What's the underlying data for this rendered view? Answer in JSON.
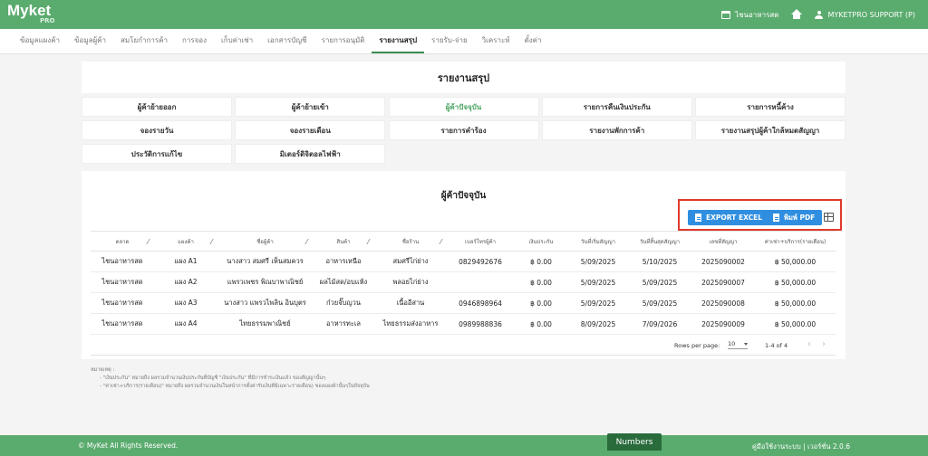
{
  "app": {
    "logo": "Myket",
    "logo_sub": "PRO"
  },
  "topbar": {
    "market_name": "ไชนอาหารสด",
    "user": "MYKETPRO SUPPORT (P)"
  },
  "nav": [
    {
      "label": "ข้อมูลแผงค้า",
      "active": false
    },
    {
      "label": "ข้อมูลผู้ค้า",
      "active": false
    },
    {
      "label": "สมโยกำการค้า",
      "active": false
    },
    {
      "label": "การจอง",
      "active": false
    },
    {
      "label": "เก็บค่าเช่า",
      "active": false
    },
    {
      "label": "เอกสารบัญชี",
      "active": false
    },
    {
      "label": "รายการอนุมัติ",
      "active": false
    },
    {
      "label": "รายงานสรุป",
      "active": true
    },
    {
      "label": "รายรับ-จ่าย",
      "active": false
    },
    {
      "label": "วิเคราะห์",
      "active": false
    },
    {
      "label": "ตั้งค่า",
      "active": false
    }
  ],
  "page_title": "รายงานสรุป",
  "reports": [
    {
      "label": "ผู้ค้าย้ายออก",
      "active": false
    },
    {
      "label": "ผู้ค้าย้ายเข้า",
      "active": false
    },
    {
      "label": "ผู้ค้าปัจจุบัน",
      "active": true
    },
    {
      "label": "รายการคืนเงินประกัน",
      "active": false
    },
    {
      "label": "รายการหนี้ค้าง",
      "active": false
    },
    {
      "label": "จองรายวัน",
      "active": false
    },
    {
      "label": "จองรายเดือน",
      "active": false
    },
    {
      "label": "รายการคำร้อง",
      "active": false
    },
    {
      "label": "รายงานพักการค้า",
      "active": false
    },
    {
      "label": "รายงานสรุปผู้ค้าใกล้หมดสัญญา",
      "active": false
    },
    {
      "label": "ประวัติการแก้ไข",
      "active": false
    },
    {
      "label": "มิเตอร์ดิจิตอลไฟฟ้า",
      "active": false
    }
  ],
  "panel": {
    "title": "ผู้ค้าปัจจุบัน",
    "export_excel": "EXPORT EXCEL",
    "print_pdf": "พิมพ์ PDF"
  },
  "table": {
    "headers": [
      "ตลาด",
      "แผงค้า",
      "ชื่อผู้ค้า",
      "สินค้า",
      "ชื่อร้าน",
      "เบอร์โทรผู้ค้า",
      "เงินประกัน",
      "วันที่เริ่มสัญญา",
      "วันที่สิ้นสุดสัญญา",
      "เลขที่สัญญา",
      "ค่าเช่า+บริการ(รายเดือน)"
    ],
    "rows": [
      [
        "ไชนอาหารสด",
        "แผง A1",
        "นางสาว สมศรี เห็นสมควร",
        "อาหารเหนือ",
        "สมศรีไก่ย่าง",
        "0829492676",
        "฿ 0.00",
        "5/09/2025",
        "5/10/2025",
        "2025090002",
        "฿ 50,000.00"
      ],
      [
        "ไชนอาหารสด",
        "แผง A2",
        "แพรวเพชร พิณบาพาณิชย์",
        "ผลไม้สด/อบแห้ง",
        "พลอยไก่ย่าง",
        "",
        "฿ 0.00",
        "5/09/2025",
        "5/09/2025",
        "2025090007",
        "฿ 50,000.00"
      ],
      [
        "ไชนอาหารสด",
        "แผง A3",
        "นางสาว แพรวไพลิน อินบุตร",
        "ก๋วยจั๊บญวน",
        "เนื้ออีสาน",
        "0946898964",
        "฿ 0.00",
        "5/09/2025",
        "5/09/2025",
        "2025090008",
        "฿ 50,000.00"
      ],
      [
        "ไชนอาหารสด",
        "แผง A4",
        "ไทยธรรมพาณิชย์",
        "อาหารทะเล",
        "ไทยธรรมส่งอาหาร",
        "0989988836",
        "฿ 0.00",
        "8/09/2025",
        "7/09/2026",
        "2025090009",
        "฿ 50,000.00"
      ]
    ]
  },
  "pager": {
    "rows_per_page_label": "Rows per page:",
    "rows_per_page": "10",
    "range": "1-4 of 4",
    "prev": "‹",
    "next": "›"
  },
  "notes": {
    "title": "หมายเหตุ :",
    "lines": [
      "- \"เงินประกัน\" หมายถึง ผลรวมจำนวนเงินประกันที่บัญชี \"เงินประกัน\" ที่มีการชำระเงินแล้ว ของสัญญานั้นๆ",
      "- \"ค่าเช่า+บริการ(รายเดือน)\" หมายถึง ผลรวมจำนวนเงินในหน้าการตั้งค่ารับเงินที่มีเฉพาะรายเดือน) ของแผงค้านั้นๆในปัจจุบัน"
    ]
  },
  "footer": {
    "copyright": "© MyKet All Rights Reserved.",
    "version": "คู่มือใช้งานระบบ | เวอร์ชั่น 2.0.6"
  },
  "overlay": {
    "numbers_tab": "Numbers"
  },
  "colors": {
    "brand_green": "#5aab6e",
    "accent_blue": "#2f8ee0",
    "highlight_red": "#e0392b",
    "active_green": "#4aa562"
  }
}
